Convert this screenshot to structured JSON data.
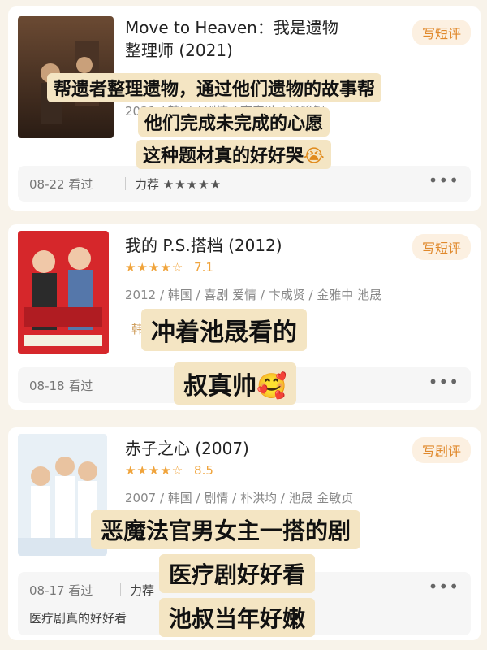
{
  "cards": [
    {
      "title_line1": "Move to Heaven：我是遗物",
      "title_line2": "整理师 (2021)",
      "button": "写短评",
      "meta_partial": "2021 / 韩国 / 剧情 / 李帝勋 / 汤晙锡",
      "footer": {
        "date": "08-22 看过",
        "rec": "力荐",
        "stars": "★★★★★",
        "more": "•••"
      },
      "overlays": [
        "帮遗者整理遗物，通过他们遗物的故事帮",
        "他们完成未完成的心愿",
        "这种题材真的好好哭"
      ],
      "overlay_emoji": "😭",
      "poster_text": "무브 투 헤븐"
    },
    {
      "title": "我的 P.S.搭档 (2012)",
      "button": "写短评",
      "stars": "★★★★☆",
      "score": "7.1",
      "meta": "2012 / 韩国 / 喜剧 爱情 / 卞成贤 / 金雅中 池晟",
      "meta_partial": "韩",
      "footer": {
        "date": "08-18 看过",
        "more": "•••"
      },
      "overlays": [
        "冲着池晟看的",
        "叔真帅"
      ],
      "overlay_emoji": "🥰",
      "poster_text": "나의 PS 파트너"
    },
    {
      "title": "赤子之心 (2007)",
      "button": "写剧评",
      "stars": "★★★★☆",
      "score": "8.5",
      "meta": "2007 / 韩国 / 剧情 / 朴洪均 / 池晟 金敏贞",
      "footer": {
        "date": "08-17 看过",
        "rec": "力荐",
        "more": "•••",
        "comment": "医疗剧真的好好看"
      },
      "overlays": [
        "恶魔法官男女主一搭的剧",
        "医疗剧好好看",
        "池叔当年好嫩"
      ],
      "poster_text": "赤子之心"
    }
  ]
}
